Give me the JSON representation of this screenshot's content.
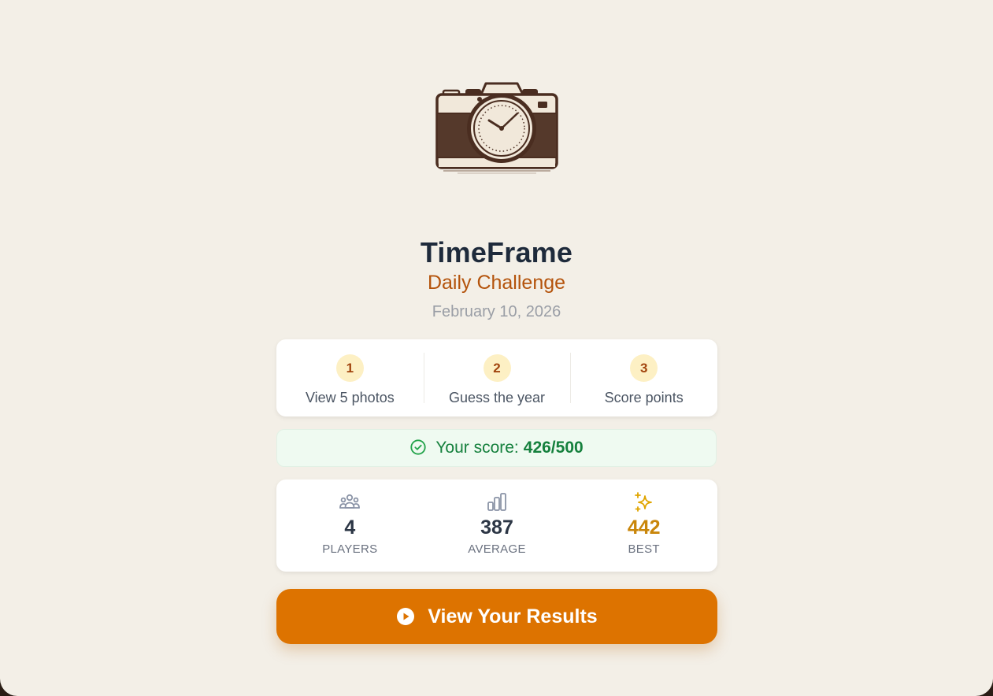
{
  "header": {
    "logo_icon": "camera-clock-icon",
    "title": "TimeFrame",
    "subtitle": "Daily Challenge",
    "date": "February 10, 2026"
  },
  "steps": [
    {
      "number": "1",
      "label": "View 5 photos"
    },
    {
      "number": "2",
      "label": "Guess the year"
    },
    {
      "number": "3",
      "label": "Score points"
    }
  ],
  "score": {
    "icon": "check-circle-icon",
    "label": "Your score:",
    "value": "426/500"
  },
  "stats": [
    {
      "icon": "users-icon",
      "value": "4",
      "label": "PLAYERS"
    },
    {
      "icon": "bar-chart-icon",
      "value": "387",
      "label": "AVERAGE"
    },
    {
      "icon": "sparkles-icon",
      "value": "442",
      "label": "BEST"
    }
  ],
  "cta": {
    "icon": "play-circle-icon",
    "label": "View Your Results"
  },
  "colors": {
    "background": "#f3efe7",
    "accent": "#dd7300",
    "subtitle": "#b4530b",
    "success": "#15803d",
    "best": "#c9860a",
    "title": "#1e2a3b"
  }
}
